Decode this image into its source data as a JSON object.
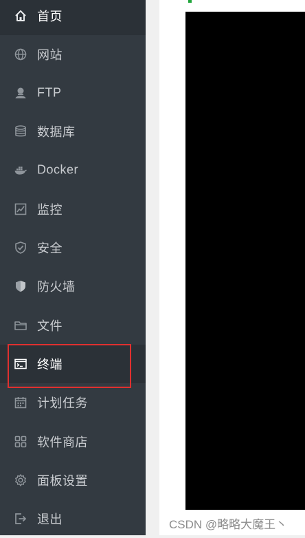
{
  "sidebar": {
    "items": [
      {
        "label": "首页",
        "icon": "home-icon"
      },
      {
        "label": "网站",
        "icon": "globe-icon"
      },
      {
        "label": "FTP",
        "icon": "ftp-user-icon"
      },
      {
        "label": "数据库",
        "icon": "database-icon"
      },
      {
        "label": "Docker",
        "icon": "docker-icon"
      },
      {
        "label": "监控",
        "icon": "monitor-chart-icon"
      },
      {
        "label": "安全",
        "icon": "shield-check-icon"
      },
      {
        "label": "防火墙",
        "icon": "firewall-shield-icon"
      },
      {
        "label": "文件",
        "icon": "folder-icon"
      },
      {
        "label": "终端",
        "icon": "terminal-icon",
        "active": true
      },
      {
        "label": "计划任务",
        "icon": "calendar-icon"
      },
      {
        "label": "软件商店",
        "icon": "app-grid-icon"
      },
      {
        "label": "面板设置",
        "icon": "gear-icon"
      },
      {
        "label": "退出",
        "icon": "logout-icon"
      }
    ]
  },
  "watermark": "CSDN @略略大魔王丶",
  "colors": {
    "sidebar_bg": "#333a41",
    "active_bg": "#2b3137",
    "highlight_border": "#e0302f",
    "accent_green": "#20a53a",
    "terminal_bg": "#000000"
  }
}
